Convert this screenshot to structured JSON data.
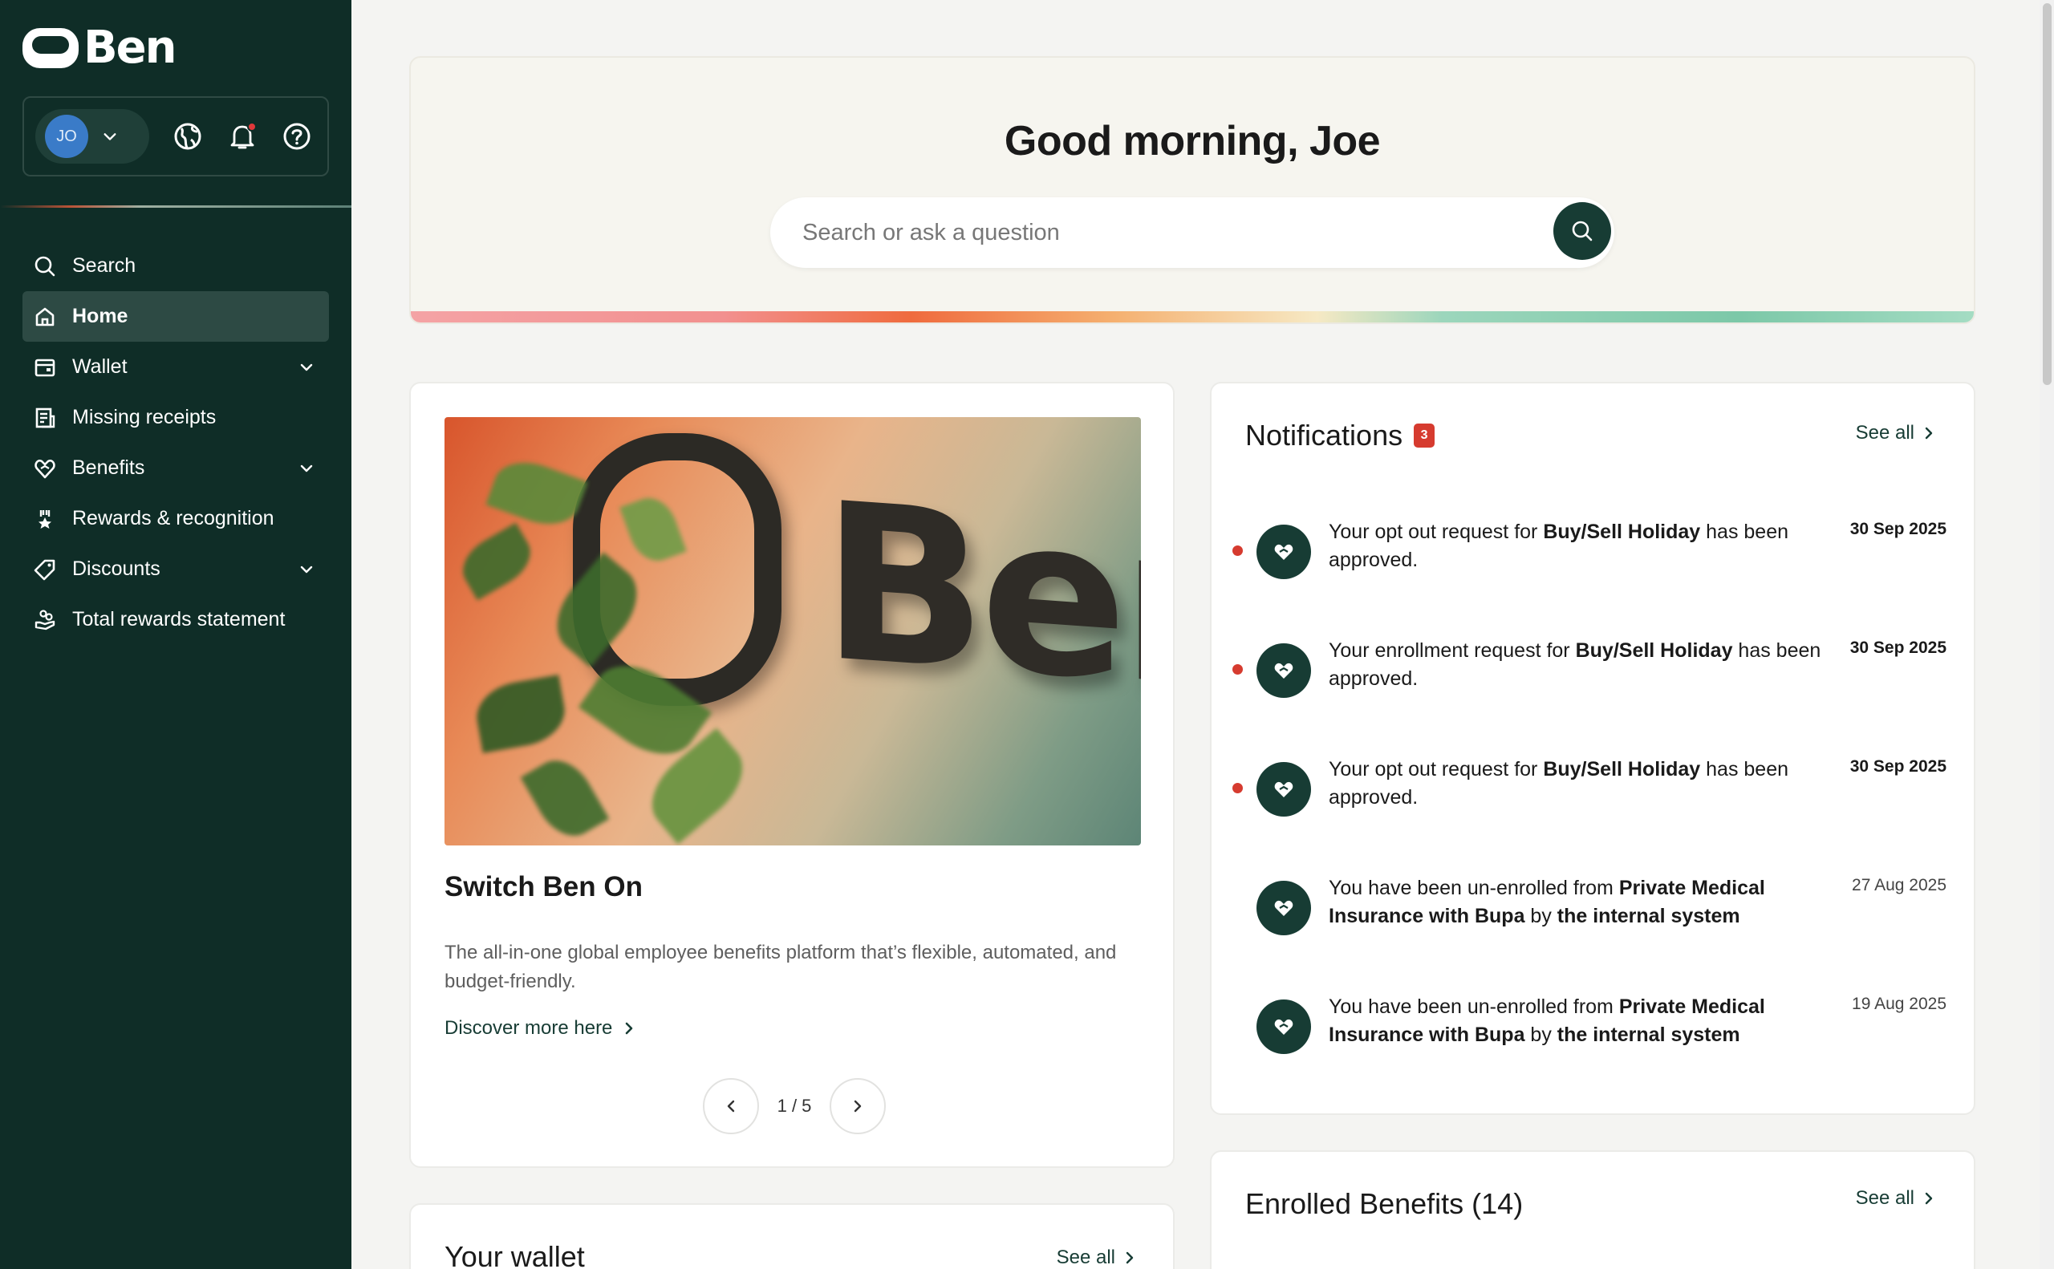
{
  "app": {
    "logo_text": "Ben"
  },
  "user": {
    "initials": "JO"
  },
  "sidebar": {
    "items": [
      {
        "label": "Search",
        "icon": "search-icon",
        "active": false,
        "has_caret": false
      },
      {
        "label": "Home",
        "icon": "home-icon",
        "active": true,
        "has_caret": false
      },
      {
        "label": "Wallet",
        "icon": "wallet-icon",
        "active": false,
        "has_caret": true
      },
      {
        "label": "Missing receipts",
        "icon": "receipt-icon",
        "active": false,
        "has_caret": false
      },
      {
        "label": "Benefits",
        "icon": "heart-hand-icon",
        "active": false,
        "has_caret": true
      },
      {
        "label": "Rewards & recognition",
        "icon": "award-icon",
        "active": false,
        "has_caret": false
      },
      {
        "label": "Discounts",
        "icon": "tag-icon",
        "active": false,
        "has_caret": true
      },
      {
        "label": "Total rewards statement",
        "icon": "hand-coins-icon",
        "active": false,
        "has_caret": false
      }
    ]
  },
  "hero": {
    "greeting": "Good morning, Joe",
    "search_placeholder": "Search or ask a question"
  },
  "promo": {
    "title": "Switch Ben On",
    "description": "The all-in-one global employee benefits platform that’s flexible, automated, and budget-friendly.",
    "link_label": "Discover more here",
    "pager": "1 / 5",
    "image_text": "Ben"
  },
  "notifications": {
    "title": "Notifications",
    "count": "3",
    "see_all": "See all",
    "items": [
      {
        "pre": "Your opt out request for ",
        "bold1": "Buy/Sell Holiday",
        "mid": " has been approved.",
        "bold2": "",
        "date": "30 Sep 2025",
        "unread": true
      },
      {
        "pre": "Your enrollment request for ",
        "bold1": "Buy/Sell Holiday",
        "mid": " has been approved.",
        "bold2": "",
        "date": "30 Sep 2025",
        "unread": true
      },
      {
        "pre": "Your opt out request for ",
        "bold1": "Buy/Sell Holiday",
        "mid": " has been approved.",
        "bold2": "",
        "date": "30 Sep 2025",
        "unread": true
      },
      {
        "pre": "You have been un-enrolled from ",
        "bold1": "Private Medical Insurance with Bupa",
        "mid": " by ",
        "bold2": "the internal system",
        "date": "27 Aug 2025",
        "unread": false
      },
      {
        "pre": "You have been un-enrolled from ",
        "bold1": "Private Medical Insurance with Bupa",
        "mid": " by ",
        "bold2": "the internal system",
        "date": "19 Aug 2025",
        "unread": false
      }
    ]
  },
  "wallet": {
    "title": "Your wallet",
    "see_all": "See all"
  },
  "enrolled": {
    "title": "Enrolled Benefits (14)",
    "see_all": "See all"
  },
  "colors": {
    "sidebar_bg": "#0f2d27",
    "accent": "#173c34",
    "badge": "#d63b2f"
  }
}
